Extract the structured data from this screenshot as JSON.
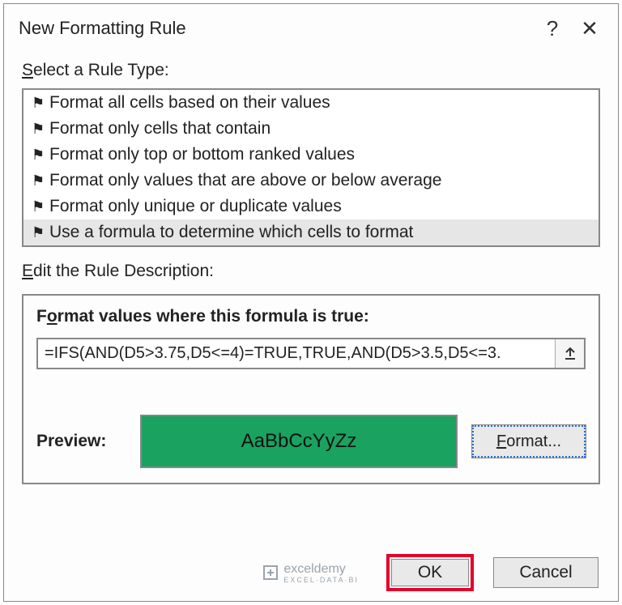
{
  "title": "New Formatting Rule",
  "select_label_pre": "S",
  "select_label_rest": "elect a Rule Type:",
  "rules": [
    "Format all cells based on their values",
    "Format only cells that contain",
    "Format only top or bottom ranked values",
    "Format only values that are above or below average",
    "Format only unique or duplicate values",
    "Use a formula to determine which cells to format"
  ],
  "selected_rule_index": 5,
  "edit_label_pre": "E",
  "edit_label_rest": "dit the Rule Description:",
  "formula_label": "Format values where this formula is true:",
  "formula_value": "=IFS(AND(D5>3.75,D5<=4)=TRUE,TRUE,AND(D5>3.5,D5<=3.",
  "preview_label": "Preview:",
  "preview_text": "AaBbCcYyZz",
  "preview_bg": "#1aa260",
  "format_btn": "Format...",
  "format_btn_ul_char": "F",
  "ok_btn": "OK",
  "cancel_btn": "Cancel",
  "watermark": "exceldemy",
  "watermark_sub": "EXCEL·DATA·BI"
}
